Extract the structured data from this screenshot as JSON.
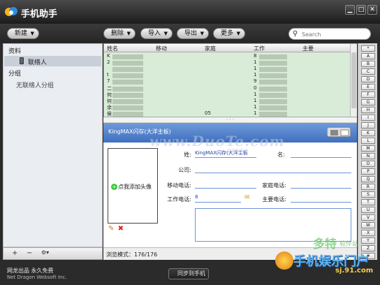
{
  "app": {
    "title": "手机助手"
  },
  "window_controls": {
    "minimize": "▁",
    "maximize": "□",
    "close": "✕"
  },
  "toolbar": {
    "new_label": "新建",
    "delete_label": "删除",
    "import_label": "导入",
    "export_label": "导出",
    "more_label": "更多",
    "search_placeholder": "Search"
  },
  "sidebar": {
    "section_data": "资料",
    "contacts": "联络人",
    "section_groups": "分组",
    "ungrouped": "无联络人分组",
    "add": "+",
    "remove": "−",
    "settings": "⚙▾"
  },
  "contact_list": {
    "columns": [
      "姓名",
      "移动",
      "家庭",
      "工作",
      "主要"
    ],
    "rows": [
      {
        "name": "K",
        "mobile": "",
        "home": "",
        "work": "8",
        "main": ""
      },
      {
        "name": "2",
        "mobile": "",
        "home": "",
        "work": "1",
        "main": ""
      },
      {
        "name": "",
        "mobile": "",
        "home": "",
        "work": "1",
        "main": ""
      },
      {
        "name": "t",
        "mobile": "",
        "home": "",
        "work": "1",
        "main": ""
      },
      {
        "name": "7",
        "mobile": "",
        "home": "",
        "work": "9",
        "main": ""
      },
      {
        "name": "二",
        "mobile": "",
        "home": "",
        "work": "0",
        "main": ""
      },
      {
        "name": "何",
        "mobile": "",
        "home": "",
        "work": "1",
        "main": ""
      },
      {
        "name": "何",
        "mobile": "",
        "home": "",
        "work": "1",
        "main": ""
      },
      {
        "name": "余",
        "mobile": "",
        "home": "",
        "work": "1",
        "main": ""
      },
      {
        "name": "侯",
        "mobile": "",
        "home": "05",
        "work": "1",
        "main": ""
      }
    ]
  },
  "detail": {
    "header_name": "KingMAX闪存(大洋主板)",
    "add_photo": "点我添加头像",
    "labels": {
      "last_name": "姓:",
      "first_name": "名:",
      "company": "公司:",
      "mobile": "移动电话:",
      "home": "家庭电话:",
      "work": "工作电话:",
      "main": "主要电话:"
    },
    "values": {
      "last_name": "KingMAX闪存(大洋主板",
      "first_name": "",
      "company": "",
      "mobile": "",
      "home": "",
      "work": "8",
      "main": ""
    },
    "edit_icon": "✎",
    "delete_icon": "✖"
  },
  "status": {
    "text": "浏览模式：176/176",
    "sync_button": "同步到手机"
  },
  "alphabet": [
    "*",
    "A",
    "B",
    "C",
    "D",
    "E",
    "F",
    "G",
    "H",
    "I",
    "J",
    "K",
    "L",
    "M",
    "N",
    "O",
    "P",
    "Q",
    "R",
    "S",
    "T",
    "U",
    "V",
    "W",
    "X",
    "Y",
    "Z",
    "#"
  ],
  "footer": {
    "line1": "网龙出品 永久免费",
    "line2": "Net Dragon Websoft Inc."
  },
  "watermarks": {
    "duote": "www.DuoTe.com",
    "duote_small": "多特软件站",
    "brand1": "多特",
    "brand1_small": "软件站",
    "brand2": "手机娱乐门户",
    "brand3": "sj.91.com"
  }
}
